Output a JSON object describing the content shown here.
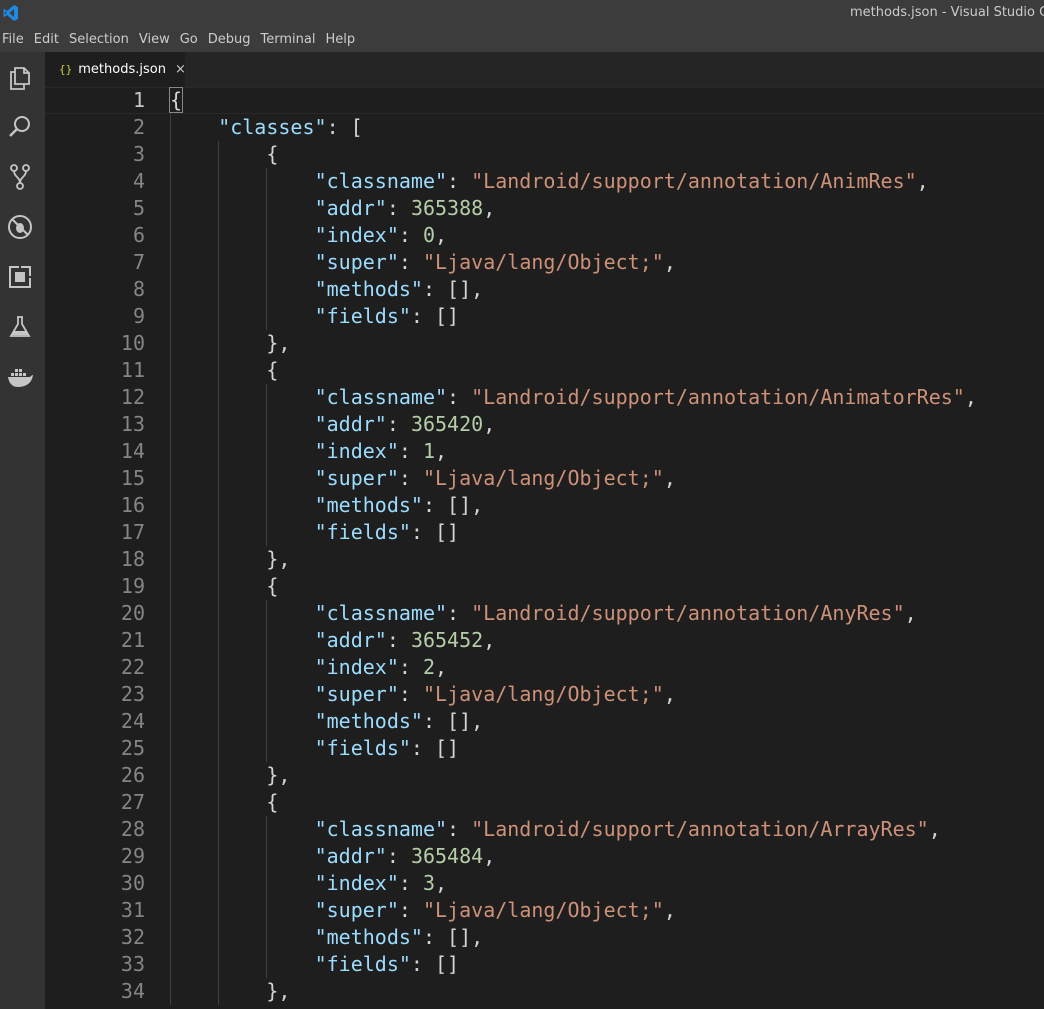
{
  "window": {
    "title": "methods.json - Visual Studio Co"
  },
  "menu": [
    "File",
    "Edit",
    "Selection",
    "View",
    "Go",
    "Debug",
    "Terminal",
    "Help"
  ],
  "activity_bar": [
    {
      "name": "explorer-icon"
    },
    {
      "name": "search-icon"
    },
    {
      "name": "source-control-icon"
    },
    {
      "name": "debug-icon"
    },
    {
      "name": "extensions-icon"
    },
    {
      "name": "test-flask-icon"
    },
    {
      "name": "docker-icon"
    }
  ],
  "tab": {
    "icon": "{}",
    "label": "methods.json",
    "close": "×"
  },
  "editor": {
    "lines": [
      {
        "n": "1",
        "indent": 0,
        "tokens": [
          [
            "p",
            "{"
          ]
        ]
      },
      {
        "n": "2",
        "indent": 1,
        "tokens": [
          [
            "k",
            "\"classes\""
          ],
          [
            "p",
            ": ["
          ]
        ]
      },
      {
        "n": "3",
        "indent": 2,
        "tokens": [
          [
            "p",
            "{"
          ]
        ]
      },
      {
        "n": "4",
        "indent": 3,
        "tokens": [
          [
            "k",
            "\"classname\""
          ],
          [
            "p",
            ": "
          ],
          [
            "s",
            "\"Landroid/support/annotation/AnimRes\""
          ],
          [
            "p",
            ","
          ]
        ]
      },
      {
        "n": "5",
        "indent": 3,
        "tokens": [
          [
            "k",
            "\"addr\""
          ],
          [
            "p",
            ": "
          ],
          [
            "n",
            "365388"
          ],
          [
            "p",
            ","
          ]
        ]
      },
      {
        "n": "6",
        "indent": 3,
        "tokens": [
          [
            "k",
            "\"index\""
          ],
          [
            "p",
            ": "
          ],
          [
            "n",
            "0"
          ],
          [
            "p",
            ","
          ]
        ]
      },
      {
        "n": "7",
        "indent": 3,
        "tokens": [
          [
            "k",
            "\"super\""
          ],
          [
            "p",
            ": "
          ],
          [
            "s",
            "\"Ljava/lang/Object;\""
          ],
          [
            "p",
            ","
          ]
        ]
      },
      {
        "n": "8",
        "indent": 3,
        "tokens": [
          [
            "k",
            "\"methods\""
          ],
          [
            "p",
            ": [],"
          ]
        ]
      },
      {
        "n": "9",
        "indent": 3,
        "tokens": [
          [
            "k",
            "\"fields\""
          ],
          [
            "p",
            ": []"
          ]
        ]
      },
      {
        "n": "10",
        "indent": 2,
        "tokens": [
          [
            "p",
            "},"
          ]
        ]
      },
      {
        "n": "11",
        "indent": 2,
        "tokens": [
          [
            "p",
            "{"
          ]
        ]
      },
      {
        "n": "12",
        "indent": 3,
        "tokens": [
          [
            "k",
            "\"classname\""
          ],
          [
            "p",
            ": "
          ],
          [
            "s",
            "\"Landroid/support/annotation/AnimatorRes\""
          ],
          [
            "p",
            ","
          ]
        ]
      },
      {
        "n": "13",
        "indent": 3,
        "tokens": [
          [
            "k",
            "\"addr\""
          ],
          [
            "p",
            ": "
          ],
          [
            "n",
            "365420"
          ],
          [
            "p",
            ","
          ]
        ]
      },
      {
        "n": "14",
        "indent": 3,
        "tokens": [
          [
            "k",
            "\"index\""
          ],
          [
            "p",
            ": "
          ],
          [
            "n",
            "1"
          ],
          [
            "p",
            ","
          ]
        ]
      },
      {
        "n": "15",
        "indent": 3,
        "tokens": [
          [
            "k",
            "\"super\""
          ],
          [
            "p",
            ": "
          ],
          [
            "s",
            "\"Ljava/lang/Object;\""
          ],
          [
            "p",
            ","
          ]
        ]
      },
      {
        "n": "16",
        "indent": 3,
        "tokens": [
          [
            "k",
            "\"methods\""
          ],
          [
            "p",
            ": [],"
          ]
        ]
      },
      {
        "n": "17",
        "indent": 3,
        "tokens": [
          [
            "k",
            "\"fields\""
          ],
          [
            "p",
            ": []"
          ]
        ]
      },
      {
        "n": "18",
        "indent": 2,
        "tokens": [
          [
            "p",
            "},"
          ]
        ]
      },
      {
        "n": "19",
        "indent": 2,
        "tokens": [
          [
            "p",
            "{"
          ]
        ]
      },
      {
        "n": "20",
        "indent": 3,
        "tokens": [
          [
            "k",
            "\"classname\""
          ],
          [
            "p",
            ": "
          ],
          [
            "s",
            "\"Landroid/support/annotation/AnyRes\""
          ],
          [
            "p",
            ","
          ]
        ]
      },
      {
        "n": "21",
        "indent": 3,
        "tokens": [
          [
            "k",
            "\"addr\""
          ],
          [
            "p",
            ": "
          ],
          [
            "n",
            "365452"
          ],
          [
            "p",
            ","
          ]
        ]
      },
      {
        "n": "22",
        "indent": 3,
        "tokens": [
          [
            "k",
            "\"index\""
          ],
          [
            "p",
            ": "
          ],
          [
            "n",
            "2"
          ],
          [
            "p",
            ","
          ]
        ]
      },
      {
        "n": "23",
        "indent": 3,
        "tokens": [
          [
            "k",
            "\"super\""
          ],
          [
            "p",
            ": "
          ],
          [
            "s",
            "\"Ljava/lang/Object;\""
          ],
          [
            "p",
            ","
          ]
        ]
      },
      {
        "n": "24",
        "indent": 3,
        "tokens": [
          [
            "k",
            "\"methods\""
          ],
          [
            "p",
            ": [],"
          ]
        ]
      },
      {
        "n": "25",
        "indent": 3,
        "tokens": [
          [
            "k",
            "\"fields\""
          ],
          [
            "p",
            ": []"
          ]
        ]
      },
      {
        "n": "26",
        "indent": 2,
        "tokens": [
          [
            "p",
            "},"
          ]
        ]
      },
      {
        "n": "27",
        "indent": 2,
        "tokens": [
          [
            "p",
            "{"
          ]
        ]
      },
      {
        "n": "28",
        "indent": 3,
        "tokens": [
          [
            "k",
            "\"classname\""
          ],
          [
            "p",
            ": "
          ],
          [
            "s",
            "\"Landroid/support/annotation/ArrayRes\""
          ],
          [
            "p",
            ","
          ]
        ]
      },
      {
        "n": "29",
        "indent": 3,
        "tokens": [
          [
            "k",
            "\"addr\""
          ],
          [
            "p",
            ": "
          ],
          [
            "n",
            "365484"
          ],
          [
            "p",
            ","
          ]
        ]
      },
      {
        "n": "30",
        "indent": 3,
        "tokens": [
          [
            "k",
            "\"index\""
          ],
          [
            "p",
            ": "
          ],
          [
            "n",
            "3"
          ],
          [
            "p",
            ","
          ]
        ]
      },
      {
        "n": "31",
        "indent": 3,
        "tokens": [
          [
            "k",
            "\"super\""
          ],
          [
            "p",
            ": "
          ],
          [
            "s",
            "\"Ljava/lang/Object;\""
          ],
          [
            "p",
            ","
          ]
        ]
      },
      {
        "n": "32",
        "indent": 3,
        "tokens": [
          [
            "k",
            "\"methods\""
          ],
          [
            "p",
            ": [],"
          ]
        ]
      },
      {
        "n": "33",
        "indent": 3,
        "tokens": [
          [
            "k",
            "\"fields\""
          ],
          [
            "p",
            ": []"
          ]
        ]
      },
      {
        "n": "34",
        "indent": 2,
        "tokens": [
          [
            "p",
            "},"
          ]
        ]
      }
    ]
  }
}
